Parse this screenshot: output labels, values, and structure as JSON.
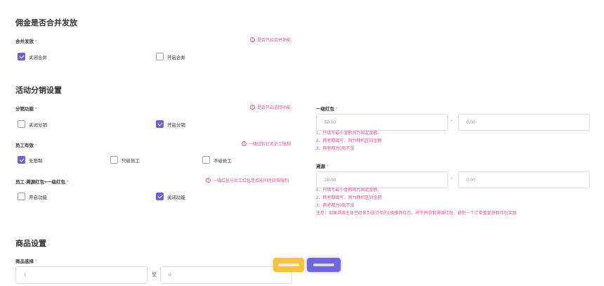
{
  "merge_section": {
    "title": "佣金是否合并发放",
    "field_label": "合并发放",
    "required": "*",
    "hint": "是否开启合并功能",
    "options": [
      {
        "label": "关闭合并",
        "checked": true
      },
      {
        "label": "开启合并",
        "checked": false
      }
    ]
  },
  "activity_section": {
    "title": "活动分销设置",
    "distribution": {
      "label": "分销功能",
      "required": "*",
      "hint": "是否开启巡回功能",
      "options": [
        {
          "label": "关闭分销",
          "checked": false
        },
        {
          "label": "开启分销",
          "checked": true
        }
      ]
    },
    "staff": {
      "label": "员工有效",
      "required": "*",
      "hint": "一级红包针对员工限制",
      "options": [
        {
          "label": "无限制",
          "checked": true
        },
        {
          "label": "只给员工",
          "checked": false
        },
        {
          "label": "不给员工",
          "checked": false
        }
      ]
    },
    "staff_source": {
      "label": "员工-溯源红包+一级红包",
      "required": "*",
      "hint": "一级红包与员工红包是否能同时获得限制",
      "options": [
        {
          "label": "开启功能",
          "checked": false
        },
        {
          "label": "关闭功能",
          "checked": true
        }
      ]
    },
    "level1": {
      "label": "一级红包",
      "required": "*",
      "min": "50.00",
      "max": "0.00",
      "separator": "-",
      "notes": [
        "1、只填写最小金额则为固定金额。",
        "2、两者都填写，则为随机区间金额",
        "3、两者都为0则不设"
      ]
    },
    "source": {
      "label": "溯源",
      "required": "*",
      "min": "20.00",
      "max": "0.00",
      "separator": "-",
      "notes": [
        "1、只填写最小金额则为固定金额。",
        "2、两者都填写，则为随机区间金额",
        "3、两者都为0则不设",
        "注意：如果溯源主体已经拿到该订单的1级推荐红包，将不再获取溯源红包，避免一个订单重复获取红包奖励"
      ]
    }
  },
  "goods_section": {
    "title": "商品设置",
    "select_label": "商品选择",
    "required": "*",
    "from_value": "1",
    "to_label": "至",
    "to_value": "0"
  },
  "colors": {
    "accent": "#6b62d6",
    "hint": "#e6559a",
    "float_yellow": "#f5c242",
    "float_purple": "#6f66e0"
  }
}
